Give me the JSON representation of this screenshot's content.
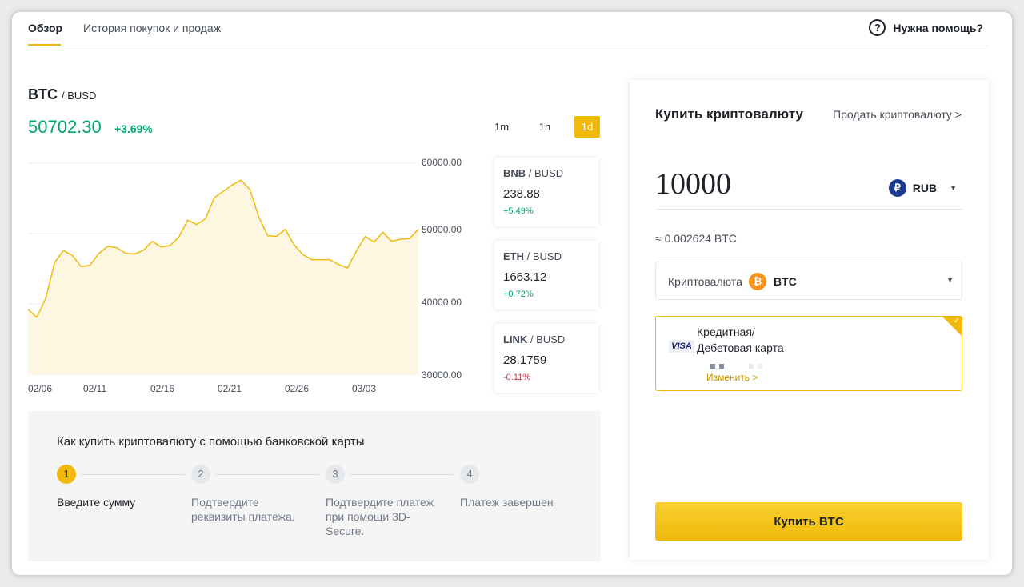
{
  "tabs": [
    {
      "label": "Обзор",
      "active": true
    },
    {
      "label": "История покупок и продаж",
      "active": false
    }
  ],
  "help": {
    "label": "Нужна помощь?",
    "icon": "question-circle-icon"
  },
  "pair": {
    "base": "BTC",
    "quote": "/ BUSD",
    "price": "50702.30",
    "change": "+3.69%"
  },
  "timeframes": [
    {
      "label": "1m",
      "active": false
    },
    {
      "label": "1h",
      "active": false
    },
    {
      "label": "1d",
      "active": true
    }
  ],
  "chart_data": {
    "type": "area",
    "x_tick_labels": [
      "02/06",
      "02/11",
      "02/16",
      "02/21",
      "02/26",
      "03/03"
    ],
    "y_tick_labels": [
      "60000.00",
      "50000.00",
      "40000.00",
      "30000.00"
    ],
    "ylim": [
      30000,
      60000
    ],
    "x": [
      0,
      0.5,
      1,
      1.5,
      2,
      2.5,
      3,
      3.5,
      4,
      4.5,
      5,
      5.5,
      6,
      6.5,
      7,
      7.5,
      8,
      8.5,
      9,
      9.5,
      10,
      10.5,
      11,
      11.5,
      12,
      12.5,
      13,
      13.5,
      14,
      14.5,
      15,
      15.5,
      16,
      16.5,
      17,
      17.5,
      18,
      18.5,
      19,
      19.5,
      20,
      20.5,
      21,
      21.5,
      22,
      22.5,
      23,
      23.5,
      24,
      24.5,
      25,
      25.5,
      26,
      26.5,
      27,
      27.5,
      28,
      28.5,
      29
    ],
    "values": [
      39200,
      38100,
      40800,
      45900,
      47600,
      46900,
      45300,
      45500,
      47200,
      48200,
      48000,
      47200,
      47100,
      47600,
      48900,
      48100,
      48300,
      49500,
      51900,
      51300,
      52100,
      55100,
      56000,
      56900,
      57600,
      56300,
      52400,
      49700,
      49600,
      50600,
      48400,
      47000,
      46300,
      46300,
      46300,
      45600,
      45100,
      47500,
      49600,
      48800,
      50200,
      48900,
      49200,
      49300,
      50600
    ],
    "color": "#f0b90b",
    "fill": "#fdf6e0",
    "grid": true
  },
  "markets": [
    {
      "base": "BNB",
      "quote": " / BUSD",
      "price": "238.88",
      "change": "+5.49%",
      "positive": true
    },
    {
      "base": "ETH",
      "quote": " / BUSD",
      "price": "1663.12",
      "change": "+0.72%",
      "positive": true
    },
    {
      "base": "LINK",
      "quote": " / BUSD",
      "price": "28.1759",
      "change": "-0.11%",
      "positive": false
    }
  ],
  "steps": {
    "title": "Как купить криптовалюту с помощью банковской карты",
    "items": [
      {
        "num": "1",
        "label": "Введите сумму",
        "active": true
      },
      {
        "num": "2",
        "label": "Подтвердите реквизиты платежа.",
        "active": false
      },
      {
        "num": "3",
        "label": "Подтвердите платеж при помощи 3D-Secure.",
        "active": false
      },
      {
        "num": "4",
        "label": "Платеж завершен",
        "active": false
      }
    ]
  },
  "buy": {
    "title": "Купить криптовалюту",
    "sell_link": "Продать криптовалюту >",
    "amount": "10000",
    "currency": "RUB",
    "currency_icon": "₽",
    "approx": "≈ 0.002624 BTC",
    "crypto_label": "Криптовалюта",
    "crypto": "BTC",
    "crypto_icon": "₿",
    "card_brand": "VISA",
    "card_name_line1": "Кредитная/",
    "card_name_line2": "Дебетовая карта",
    "card_change": "Изменить >",
    "button": "Купить BTC"
  },
  "colors": {
    "accent": "#f0b90b",
    "up": "#03a66d",
    "down": "#cf304a",
    "text": "#1e2329"
  }
}
